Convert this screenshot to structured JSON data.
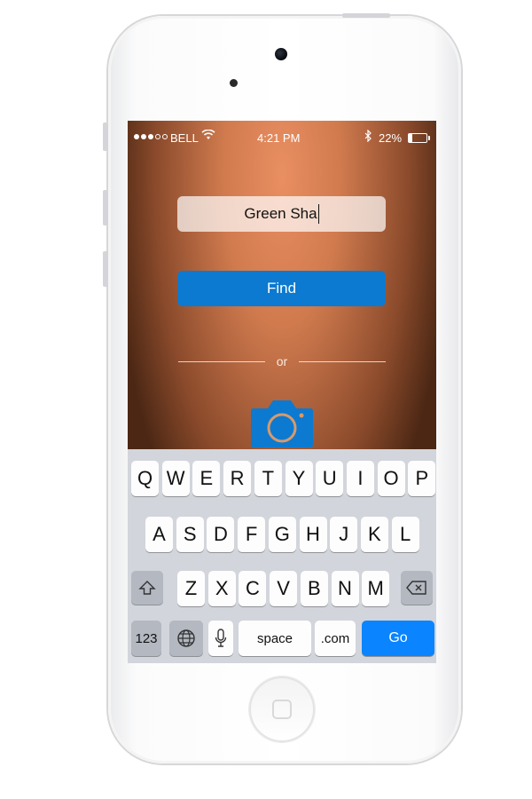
{
  "status_bar": {
    "carrier": "BELL",
    "time": "4:21 PM",
    "battery_percent": "22%",
    "battery_level": 0.22,
    "signal_bars_filled": 3,
    "signal_bars_total": 5
  },
  "search": {
    "value": "Green Sha"
  },
  "find_button": {
    "label": "Find"
  },
  "divider": {
    "text": "or"
  },
  "camera_button": {
    "icon": "camera-icon",
    "color": "#0c7ad0"
  },
  "keyboard": {
    "row1": [
      "Q",
      "W",
      "E",
      "R",
      "T",
      "Y",
      "U",
      "I",
      "O",
      "P"
    ],
    "row2": [
      "A",
      "S",
      "D",
      "F",
      "G",
      "H",
      "J",
      "K",
      "L"
    ],
    "row3": [
      "Z",
      "X",
      "C",
      "V",
      "B",
      "N",
      "M"
    ],
    "numbers_key": "123",
    "space_key": "space",
    "dotcom_key": ".com",
    "go_key": "Go",
    "shift_icon": "shift-icon",
    "delete_icon": "delete-icon",
    "globe_icon": "globe-icon",
    "mic_icon": "microphone-icon"
  },
  "colors": {
    "accent": "#0c7ad0",
    "go_key": "#0a84ff"
  }
}
